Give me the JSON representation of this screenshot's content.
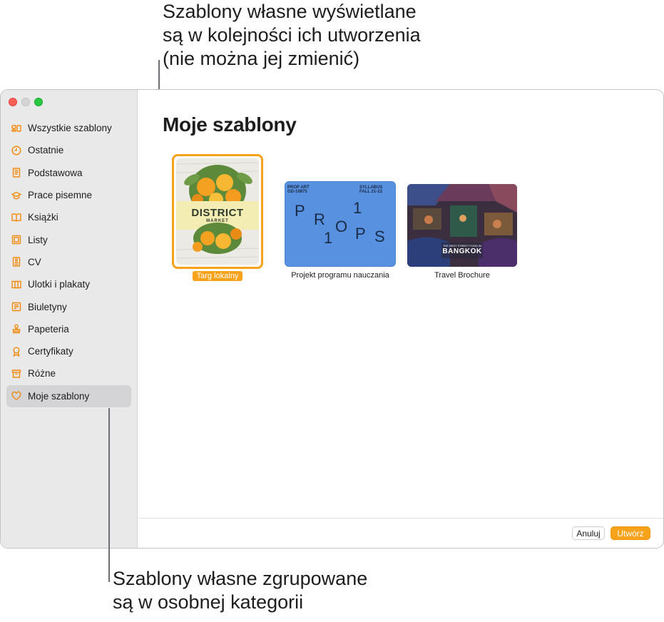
{
  "callouts": {
    "top": [
      "Szablony własne wyświetlane",
      "są w kolejności ich utworzenia",
      "(nie można jej zmienić)"
    ],
    "bottom": [
      "Szablony własne zgrupowane",
      "są w osobnej kategorii"
    ]
  },
  "sidebar": {
    "items": [
      {
        "label": "Wszystkie szablony",
        "icon": "grid-icon"
      },
      {
        "label": "Ostatnie",
        "icon": "clock-icon"
      },
      {
        "label": "Podstawowa",
        "icon": "document-icon"
      },
      {
        "label": "Prace pisemne",
        "icon": "graduation-cap-icon"
      },
      {
        "label": "Książki",
        "icon": "book-icon"
      },
      {
        "label": "Listy",
        "icon": "letter-icon"
      },
      {
        "label": "CV",
        "icon": "resume-icon"
      },
      {
        "label": "Ulotki i plakaty",
        "icon": "flyer-icon"
      },
      {
        "label": "Biuletyny",
        "icon": "newsletter-icon"
      },
      {
        "label": "Papeteria",
        "icon": "stamp-icon"
      },
      {
        "label": "Certyfikaty",
        "icon": "ribbon-icon"
      },
      {
        "label": "Różne",
        "icon": "box-icon"
      },
      {
        "label": "Moje szablony",
        "icon": "heart-icon",
        "selected": true
      }
    ]
  },
  "main": {
    "title": "Moje szablony",
    "templates": [
      {
        "label": "Targ lokalny",
        "selected": true,
        "thumb_title": "DISTRICT",
        "thumb_subtitle": "MARKET"
      },
      {
        "label": "Projekt programu nauczania",
        "thumb_lines": [
          "PROP ART",
          "GD-10875",
          "SYLLABUS",
          "FALL 21-22"
        ],
        "thumb_letters": [
          "P",
          "R",
          "1",
          "O",
          "1",
          "P",
          "S"
        ]
      },
      {
        "label": "Travel Brochure",
        "thumb_small": "THE BEST STREET FOOD IN",
        "thumb_title": "BANGKOK"
      }
    ]
  },
  "footer": {
    "cancel": "Anuluj",
    "create": "Utwórz"
  },
  "colors": {
    "accent": "#f7a21b",
    "sidebar_bg": "#e9e9ea"
  }
}
